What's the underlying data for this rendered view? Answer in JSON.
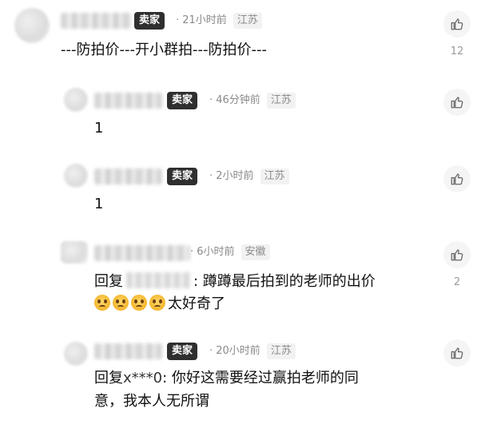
{
  "comments": [
    {
      "badge": "卖家",
      "time": "21小时前",
      "location": "江苏",
      "content": "---防拍价---开小群拍---防拍价---",
      "like_count": "12"
    },
    {
      "badge": "卖家",
      "time": "46分钟前",
      "location": "江苏",
      "content": "1",
      "like_count": ""
    },
    {
      "badge": "卖家",
      "time": "2小时前",
      "location": "江苏",
      "content": "1",
      "like_count": ""
    },
    {
      "badge": "",
      "time": "6小时前",
      "location": "安徽",
      "reply_prefix": "回复",
      "content": ":  蹲蹲最后拍到的老师的出价",
      "content2": "太好奇了",
      "like_count": "2"
    },
    {
      "badge": "卖家",
      "time": "20小时前",
      "location": "江苏",
      "reply_prefix": "回复",
      "reply_user": "x***0",
      "content": ":   你好这需要经过赢拍老师的同",
      "content2": "意，我本人无所谓",
      "like_count": ""
    }
  ],
  "icons": {
    "like": "thumbs-up-icon",
    "emoji": "pleading-face-icon"
  }
}
